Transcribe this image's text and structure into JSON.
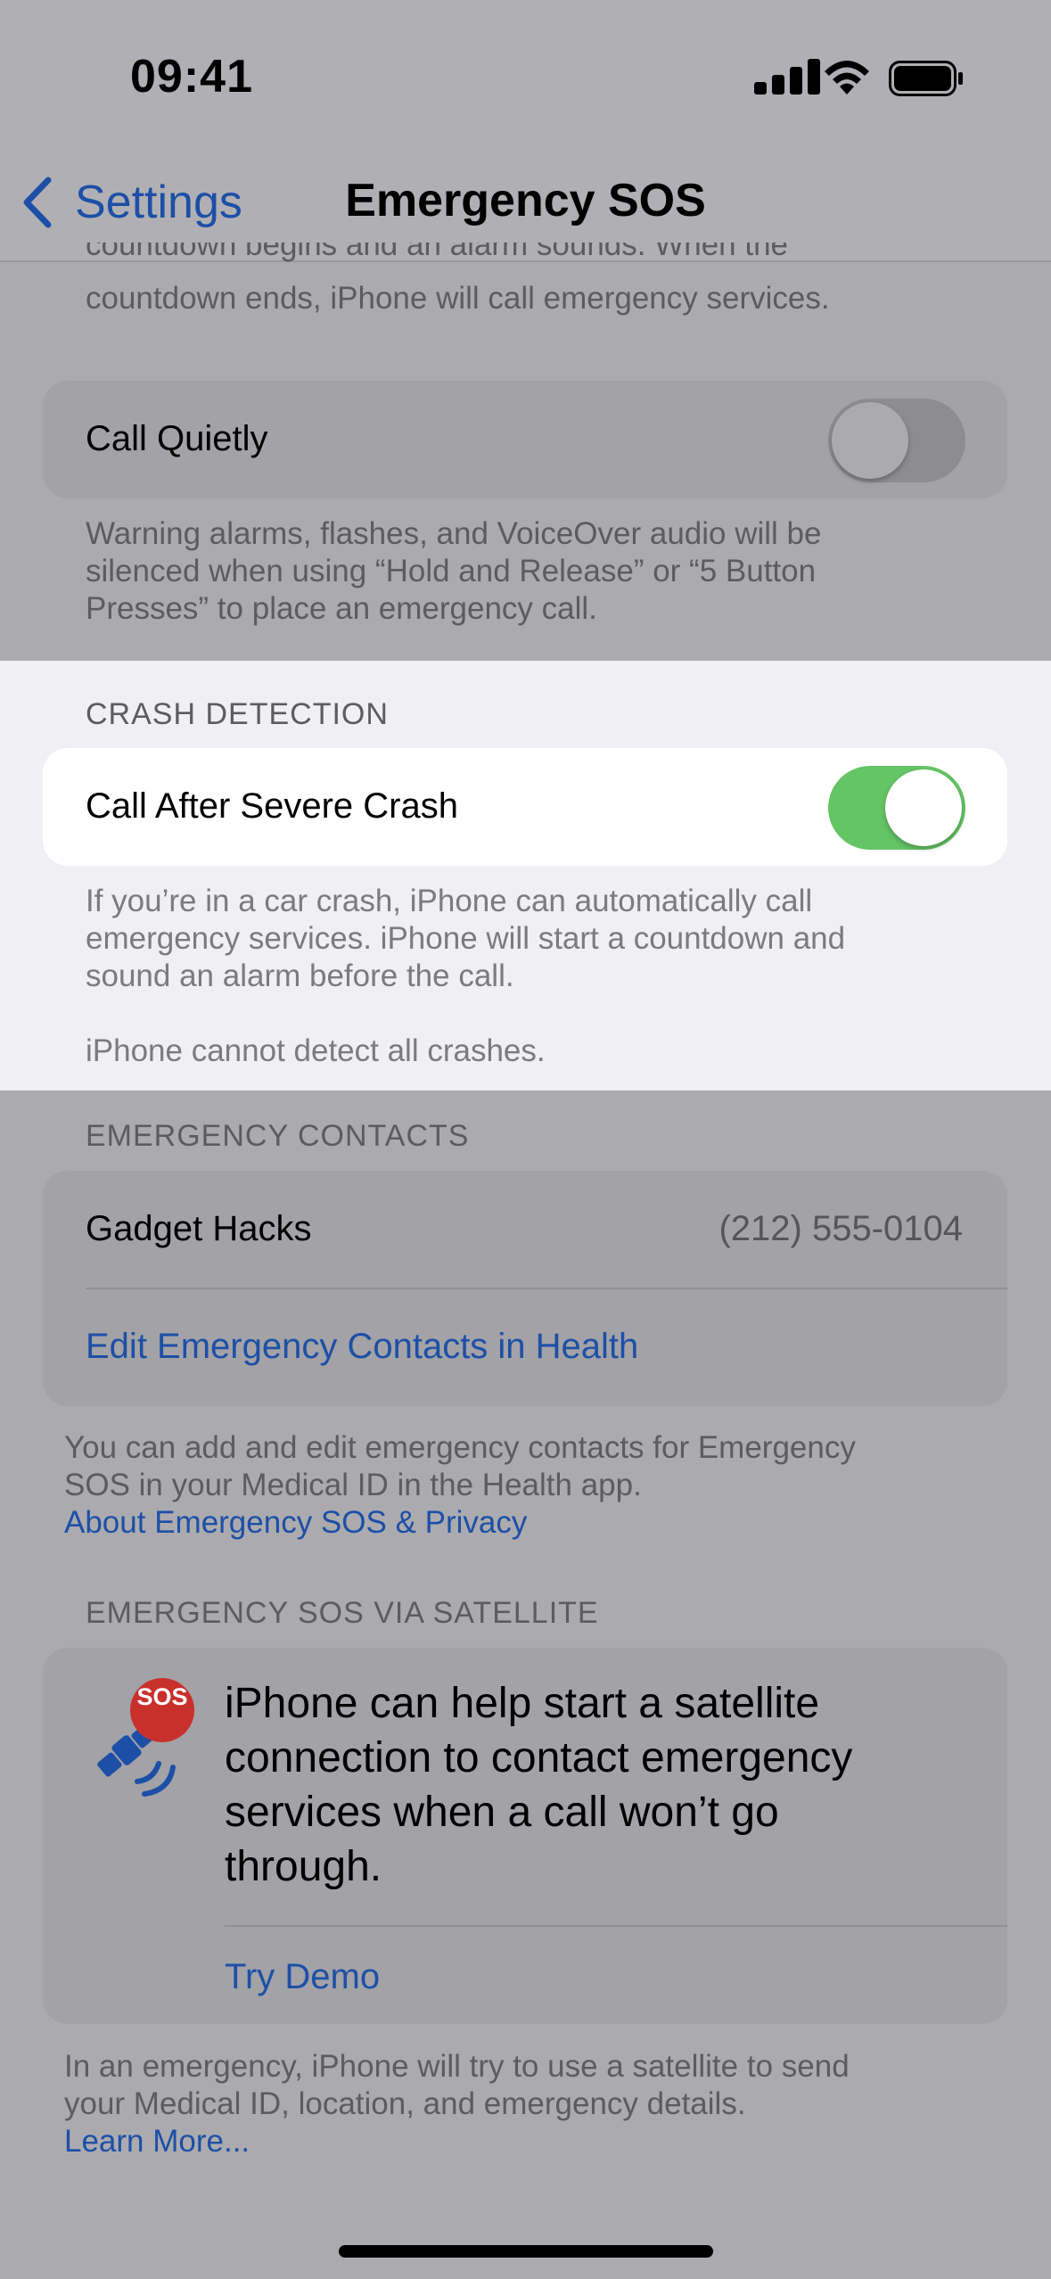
{
  "status_bar": {
    "time": "09:41",
    "icons": [
      "cellular-signal-icon",
      "wifi-icon",
      "battery-icon"
    ]
  },
  "nav": {
    "back_label": "Settings",
    "title": "Emergency SOS"
  },
  "top_footer": {
    "line1": "countdown begins and an alarm sounds. When the",
    "line2": "countdown ends, iPhone will call emergency services."
  },
  "call_quietly": {
    "label": "Call Quietly",
    "enabled": false,
    "footer_line1": "Warning alarms, flashes, and VoiceOver audio will be",
    "footer_line2": "silenced when using “Hold and Release” or “5 Button",
    "footer_line3": "Presses” to place an emergency call."
  },
  "crash_detection": {
    "header": "CRASH DETECTION",
    "label": "Call After Severe Crash",
    "enabled": true,
    "footer_line1": "If you’re in a car crash, iPhone can automatically call",
    "footer_line2": "emergency services. iPhone will start a countdown and",
    "footer_line3": "sound an alarm before the call.",
    "note": "iPhone cannot detect all crashes."
  },
  "emergency_contacts": {
    "header": "EMERGENCY CONTACTS",
    "contact_name": "Gadget Hacks",
    "contact_phone": "(212) 555-0104",
    "edit_link": "Edit Emergency Contacts in Health",
    "footer_line1": "You can add and edit emergency contacts for Emergency",
    "footer_line2": "SOS in your Medical ID in the Health app.",
    "privacy_link": "About Emergency SOS & Privacy"
  },
  "satellite": {
    "header": "EMERGENCY SOS VIA SATELLITE",
    "badge": "SOS",
    "body_line1": "iPhone can help start a satellite",
    "body_line2": "connection to contact emergency",
    "body_line3": "services when a call won’t go",
    "body_line4": "through.",
    "demo_button": "Try Demo",
    "footer_line1": "In an emergency, iPhone will try to use a satellite to send",
    "footer_line2": "your Medical ID, location, and emergency details.",
    "learn_more": "Learn More..."
  },
  "colors": {
    "accent": "#1d4fa6",
    "switch_on": "#65c466",
    "sos_red": "#c9302c"
  }
}
